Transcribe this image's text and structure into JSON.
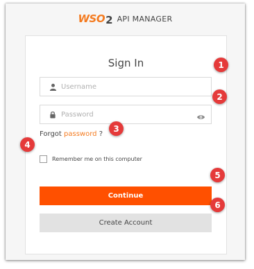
{
  "header": {
    "logo_wso": "WSO",
    "logo_two": "2",
    "product": "API MANAGER"
  },
  "login": {
    "title": "Sign In",
    "username_placeholder": "Username",
    "password_placeholder": "Password",
    "forgot_prefix": "Forgot",
    "forgot_link": "password",
    "forgot_suffix": "?",
    "remember_label": "Remember me on this computer",
    "continue_label": "Continue",
    "create_account_label": "Create Account"
  },
  "callouts": [
    "1",
    "2",
    "3",
    "4",
    "5",
    "6"
  ],
  "colors": {
    "accent": "#ff5000",
    "link": "#f47b20",
    "callout": "#e53a3a",
    "secondary_button": "#e2e2e2"
  }
}
